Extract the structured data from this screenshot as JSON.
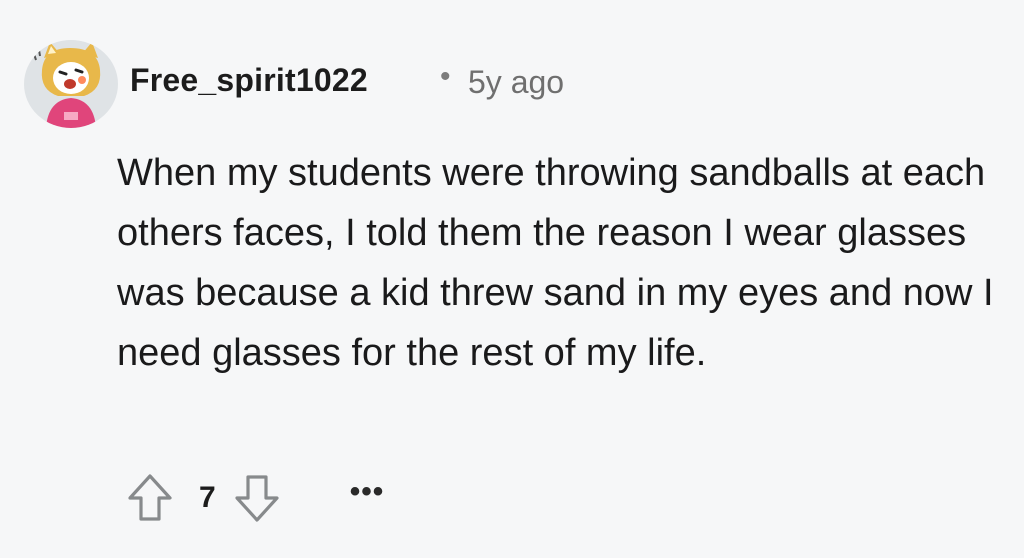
{
  "comment": {
    "author": "Free_spirit1022",
    "separator": "•",
    "timestamp": "5y ago",
    "body": "When my students were throwing sandballs at each others faces, I told them the reason I wear glasses was because a kid threw sand in my eyes and now I need glasses for the rest of my life.",
    "score": "7",
    "more_label": "•••"
  },
  "icons": {
    "upvote": "arrow-up-outline",
    "downvote": "arrow-down-outline",
    "avatar": "snoo-dog-costume-avatar"
  },
  "colors": {
    "background": "#f6f7f8",
    "text": "#1a1a1b",
    "muted": "#6f6f6f",
    "icon": "#878a8c"
  }
}
